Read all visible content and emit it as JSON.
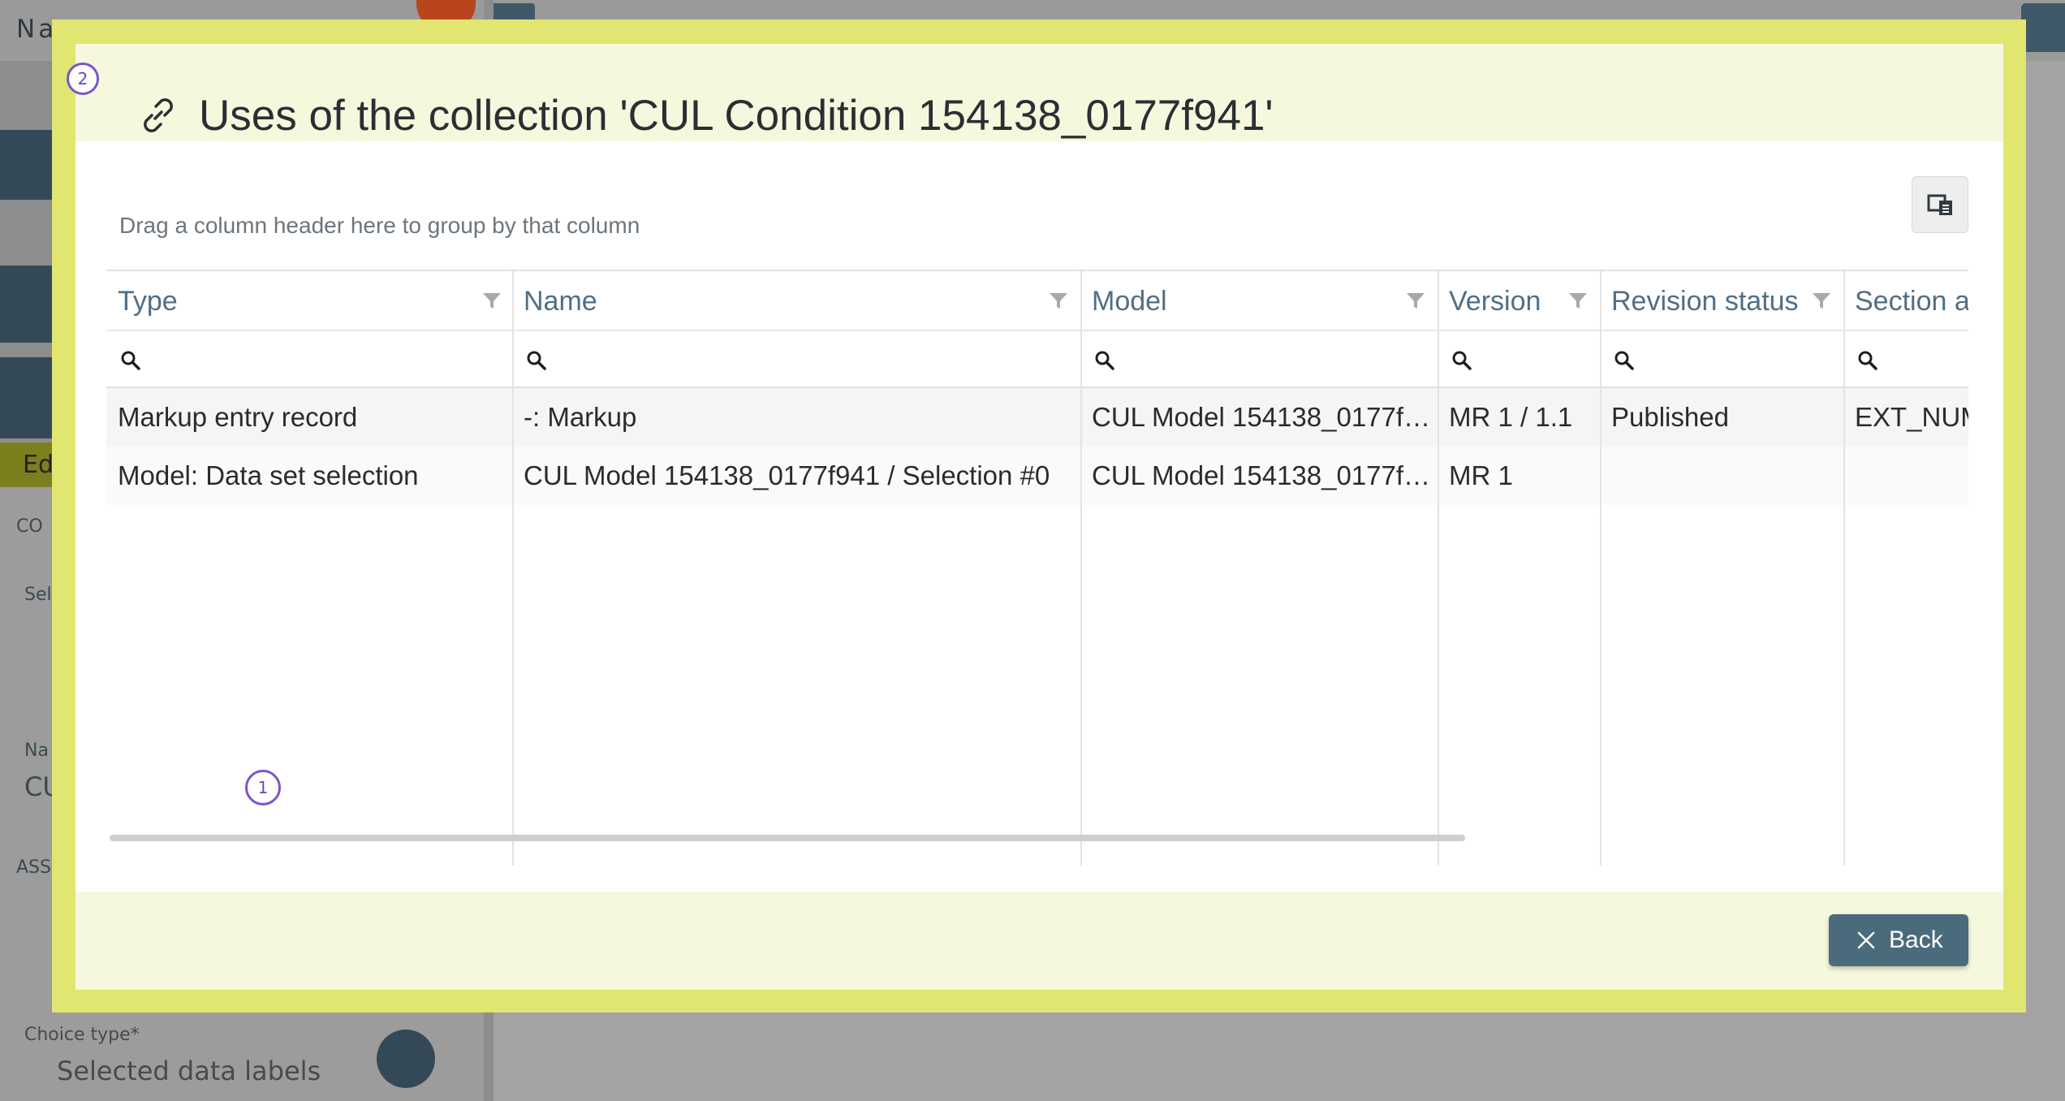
{
  "background": {
    "app_title": "Na",
    "edit_tab_label": "Ed",
    "section_label_1": "CO",
    "section_label_2": "ASS",
    "field_label_sel": "Sel",
    "field_label_na": "Na",
    "field_value_cu": "CU",
    "choice_type_label": "Choice type*",
    "choice_type_value": "Selected data labels"
  },
  "modal": {
    "title": "Uses of the collection 'CUL Condition 154138_0177f941'",
    "header_badge": "2",
    "overlay_badge": "1",
    "group_panel_text": "Drag a column header here to group by that column",
    "back_label": "Back",
    "accent_color": "#e0e670",
    "header_color": "#4f6f86"
  },
  "grid": {
    "columns": [
      "Type",
      "Name",
      "Model",
      "Version",
      "Revision status",
      "Section a"
    ],
    "rows": [
      {
        "type": "Markup entry record",
        "name": "-: Markup",
        "model": "CUL Model 154138_0177f…",
        "version": "MR 1 / 1.1",
        "revision_status": "Published",
        "section": "EXT_NUM"
      },
      {
        "type": "Model: Data set selection",
        "name": "CUL Model 154138_0177f941 / Selection #0",
        "model": "CUL Model 154138_0177f…",
        "version": "MR 1",
        "revision_status": "",
        "section": ""
      }
    ]
  }
}
